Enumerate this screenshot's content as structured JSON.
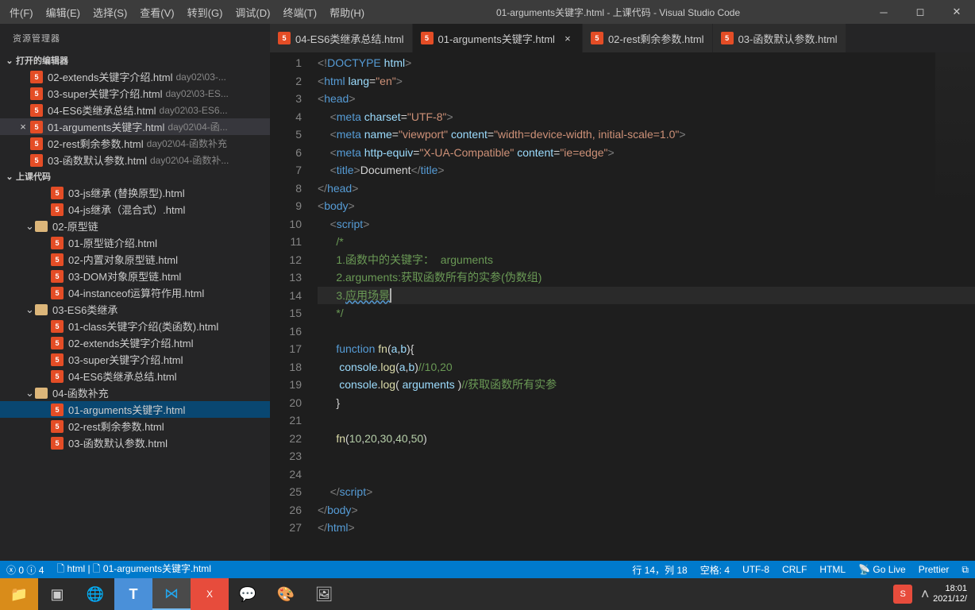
{
  "menu": [
    "件(F)",
    "编辑(E)",
    "选择(S)",
    "查看(V)",
    "转到(G)",
    "调试(D)",
    "终端(T)",
    "帮助(H)"
  ],
  "window_title": "01-arguments关键字.html - 上课代码 - Visual Studio Code",
  "sidebar": {
    "title": "资源管理器",
    "open_editors_label": "打开的编辑器",
    "open_editors": [
      {
        "name": "02-extends关键字介绍.html",
        "path": "day02\\03-..."
      },
      {
        "name": "03-super关键字介绍.html",
        "path": "day02\\03-ES..."
      },
      {
        "name": "04-ES6类继承总结.html",
        "path": "day02\\03-ES6..."
      },
      {
        "name": "01-arguments关键字.html",
        "path": "day02\\04-函...",
        "active": true
      },
      {
        "name": "02-rest剩余参数.html",
        "path": "day02\\04-函数补充"
      },
      {
        "name": "03-函数默认参数.html",
        "path": "day02\\04-函数补..."
      }
    ],
    "workspace_label": "上课代码",
    "tree": [
      {
        "level": 3,
        "type": "file",
        "name": "03-js继承 (替换原型).html"
      },
      {
        "level": 3,
        "type": "file",
        "name": "04-js继承（混合式）.html"
      },
      {
        "level": 2,
        "type": "folder",
        "name": "02-原型链",
        "open": true
      },
      {
        "level": 3,
        "type": "file",
        "name": "01-原型链介绍.html"
      },
      {
        "level": 3,
        "type": "file",
        "name": "02-内置对象原型链.html"
      },
      {
        "level": 3,
        "type": "file",
        "name": "03-DOM对象原型链.html"
      },
      {
        "level": 3,
        "type": "file",
        "name": "04-instanceof运算符作用.html"
      },
      {
        "level": 2,
        "type": "folder",
        "name": "03-ES6类继承",
        "open": true
      },
      {
        "level": 3,
        "type": "file",
        "name": "01-class关键字介绍(类函数).html"
      },
      {
        "level": 3,
        "type": "file",
        "name": "02-extends关键字介绍.html"
      },
      {
        "level": 3,
        "type": "file",
        "name": "03-super关键字介绍.html"
      },
      {
        "level": 3,
        "type": "file",
        "name": "04-ES6类继承总结.html"
      },
      {
        "level": 2,
        "type": "folder",
        "name": "04-函数补充",
        "open": true
      },
      {
        "level": 3,
        "type": "file",
        "name": "01-arguments关键字.html",
        "active": true
      },
      {
        "level": 3,
        "type": "file",
        "name": "02-rest剩余参数.html"
      },
      {
        "level": 3,
        "type": "file",
        "name": "03-函数默认参数.html"
      }
    ]
  },
  "tabs": [
    {
      "name": "04-ES6类继承总结.html"
    },
    {
      "name": "01-arguments关键字.html",
      "active": true
    },
    {
      "name": "02-rest剩余参数.html"
    },
    {
      "name": "03-函数默认参数.html"
    }
  ],
  "line_count": 27,
  "status": {
    "errors": "0",
    "warnings": "0",
    "info": "4",
    "lang_icon": "html",
    "breadcrumb": "01-arguments关键字.html",
    "ln_col": "行 14，列 18",
    "spaces": "空格: 4",
    "encoding": "UTF-8",
    "eol": "CRLF",
    "language": "HTML",
    "golive": "Go Live",
    "prettier": "Prettier"
  },
  "taskbar": {
    "time": "18:01",
    "date": "2021/12/"
  }
}
